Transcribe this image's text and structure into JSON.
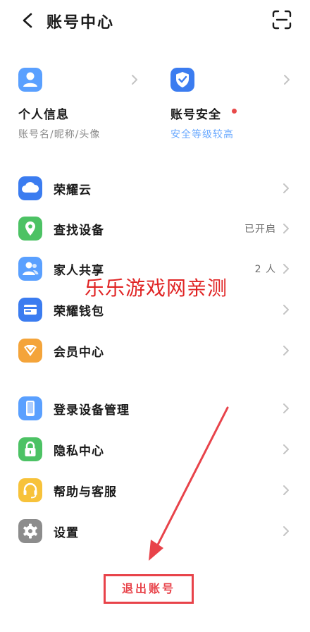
{
  "header": {
    "title": "账号中心"
  },
  "cards": [
    {
      "title": "个人信息",
      "subtitle": "账号名/昵称/头像",
      "icon": "person-icon"
    },
    {
      "title": "账号安全",
      "subtitle": "安全等级较高",
      "icon": "shield-check-icon"
    }
  ],
  "menu1": [
    {
      "label": "荣耀云",
      "value": "",
      "icon": "cloud-icon"
    },
    {
      "label": "查找设备",
      "value": "已开启",
      "icon": "location-icon"
    },
    {
      "label": "家人共享",
      "value": "2 人",
      "icon": "family-icon"
    },
    {
      "label": "荣耀钱包",
      "value": "",
      "icon": "wallet-icon"
    },
    {
      "label": "会员中心",
      "value": "",
      "icon": "vip-icon"
    }
  ],
  "menu2": [
    {
      "label": "登录设备管理",
      "value": "",
      "icon": "phone-icon"
    },
    {
      "label": "隐私中心",
      "value": "",
      "icon": "lock-icon"
    },
    {
      "label": "帮助与客服",
      "value": "",
      "icon": "headset-icon"
    },
    {
      "label": "设置",
      "value": "",
      "icon": "gear-icon"
    }
  ],
  "watermark": "乐乐游戏网亲测",
  "logout_label": "退出账号",
  "colors": {
    "accent_red": "#e8434a",
    "blue": "#3b7cf0",
    "green": "#4cc264",
    "orange": "#f4a43a",
    "grey": "#8c8c8c"
  }
}
